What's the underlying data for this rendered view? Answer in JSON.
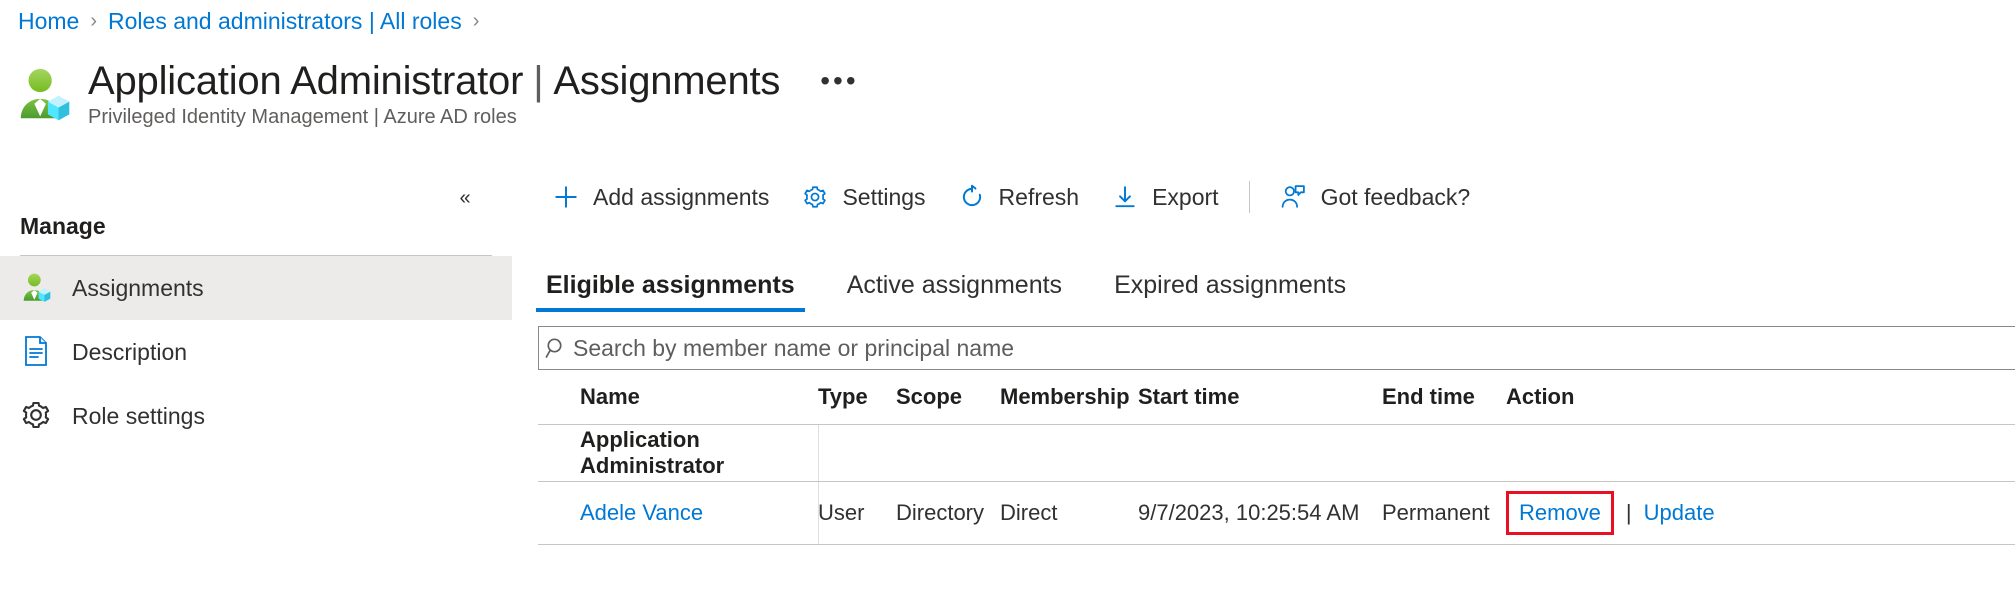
{
  "breadcrumb": {
    "items": [
      {
        "label": "Home"
      },
      {
        "label": "Roles and administrators | All roles"
      }
    ],
    "separator": "›"
  },
  "header": {
    "title": "Application Administrator",
    "title_separator": "|",
    "title_suffix": "Assignments",
    "subtitle": "Privileged Identity Management | Azure AD roles",
    "more_label": "•••",
    "icon": "user-role-icon"
  },
  "sidebar": {
    "collapse_label": "«",
    "section_title": "Manage",
    "items": [
      {
        "label": "Assignments",
        "icon": "user-role-icon",
        "selected": true
      },
      {
        "label": "Description",
        "icon": "document-icon",
        "selected": false
      },
      {
        "label": "Role settings",
        "icon": "gear-icon",
        "selected": false
      }
    ]
  },
  "toolbar": {
    "buttons": [
      {
        "label": "Add assignments",
        "icon": "plus-icon"
      },
      {
        "label": "Settings",
        "icon": "gear-icon"
      },
      {
        "label": "Refresh",
        "icon": "refresh-icon"
      },
      {
        "label": "Export",
        "icon": "download-icon"
      }
    ],
    "feedback": {
      "label": "Got feedback?",
      "icon": "feedback-person-icon"
    }
  },
  "tabs": [
    {
      "label": "Eligible assignments",
      "active": true
    },
    {
      "label": "Active assignments",
      "active": false
    },
    {
      "label": "Expired assignments",
      "active": false
    }
  ],
  "search": {
    "placeholder": "Search by member name or principal name",
    "value": "",
    "icon": "search-icon"
  },
  "table": {
    "columns": [
      "Name",
      "Type",
      "Scope",
      "Membership",
      "Start time",
      "End time",
      "Action"
    ],
    "groups": [
      {
        "group_label": "Application Administrator",
        "rows": [
          {
            "name": "Adele Vance",
            "type": "User",
            "scope": "Directory",
            "membership": "Direct",
            "start_time": "9/7/2023, 10:25:54 AM",
            "end_time": "Permanent",
            "actions": {
              "remove": "Remove",
              "separator": "|",
              "update": "Update"
            }
          }
        ]
      }
    ]
  },
  "colors": {
    "accent": "#0078d4",
    "highlight_box": "#e81123",
    "text": "#323130",
    "selected_row_bg": "#edebe9"
  }
}
